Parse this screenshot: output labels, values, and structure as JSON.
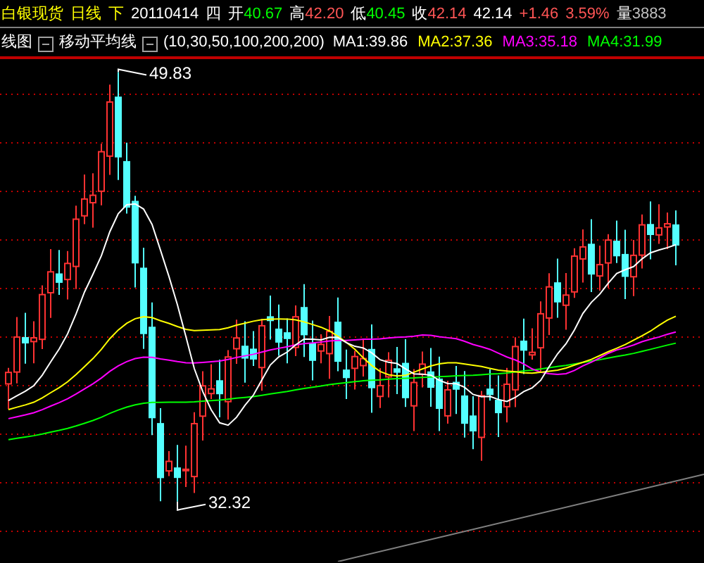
{
  "quote_bar": [
    {
      "value": "白银现货",
      "color": "#ffff00"
    },
    {
      "value": "日线",
      "color": "#ffff00"
    },
    {
      "value": "下",
      "color": "#ffff00"
    },
    {
      "value": "20110414",
      "color": "#ffffff"
    },
    {
      "value": "四",
      "color": "#ffffff"
    },
    {
      "label": "开",
      "value": "40.67",
      "color": "#00ff00"
    },
    {
      "label": "高",
      "value": "42.20",
      "color": "#ff5555"
    },
    {
      "label": "低",
      "value": "40.45",
      "color": "#00ff00"
    },
    {
      "label": "收",
      "value": "42.14",
      "color": "#ff5555"
    },
    {
      "value": "42.14",
      "color": "#ffffff"
    },
    {
      "value": "+1.46",
      "color": "#ff5555"
    },
    {
      "value": "3.59%",
      "color": "#ff5555"
    },
    {
      "label": "量",
      "value": "3883",
      "color": "#c0c0c0"
    }
  ],
  "indicator_bar": {
    "chart_type": "线图",
    "indicator": "移动平均线",
    "params": "(10,30,50,100,200,200)",
    "averages": [
      {
        "text": "MA1:39.86",
        "color": "#ffffff"
      },
      {
        "text": "MA2:37.36",
        "color": "#ffff00"
      },
      {
        "text": "MA3:35.18",
        "color": "#ff00ff"
      },
      {
        "text": "MA4:31.99",
        "color": "#00ff00"
      }
    ]
  },
  "chart": {
    "high_label": "49.83",
    "low_label": "32.32"
  }
}
